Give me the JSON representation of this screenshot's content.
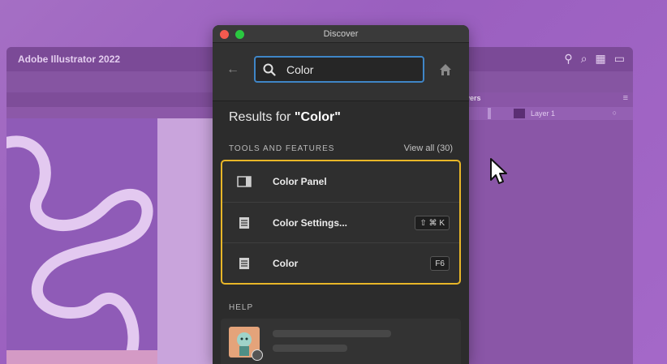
{
  "background_app": {
    "title": "Adobe Illustrator 2022",
    "layers_tab": "yers",
    "layer_name": "Layer 1"
  },
  "discover": {
    "window_title": "Discover",
    "search": {
      "value": "Color",
      "icon": "search-icon"
    },
    "results_prefix": "Results for ",
    "query_quoted": "\"Color\"",
    "tools_section": {
      "label": "TOOLS AND FEATURES",
      "view_all": "View all (30)"
    },
    "results": [
      {
        "label": "Color Panel",
        "icon": "panel-icon",
        "shortcut": ""
      },
      {
        "label": "Color Settings...",
        "icon": "menu-icon",
        "shortcut": "⇧ ⌘ K"
      },
      {
        "label": "Color",
        "icon": "menu-icon",
        "shortcut": "F6"
      }
    ],
    "help_section": {
      "label": "HELP"
    }
  },
  "colors": {
    "highlight": "#e8b628",
    "search_border": "#3f86c7",
    "panel_bg": "#2c2c2c"
  }
}
